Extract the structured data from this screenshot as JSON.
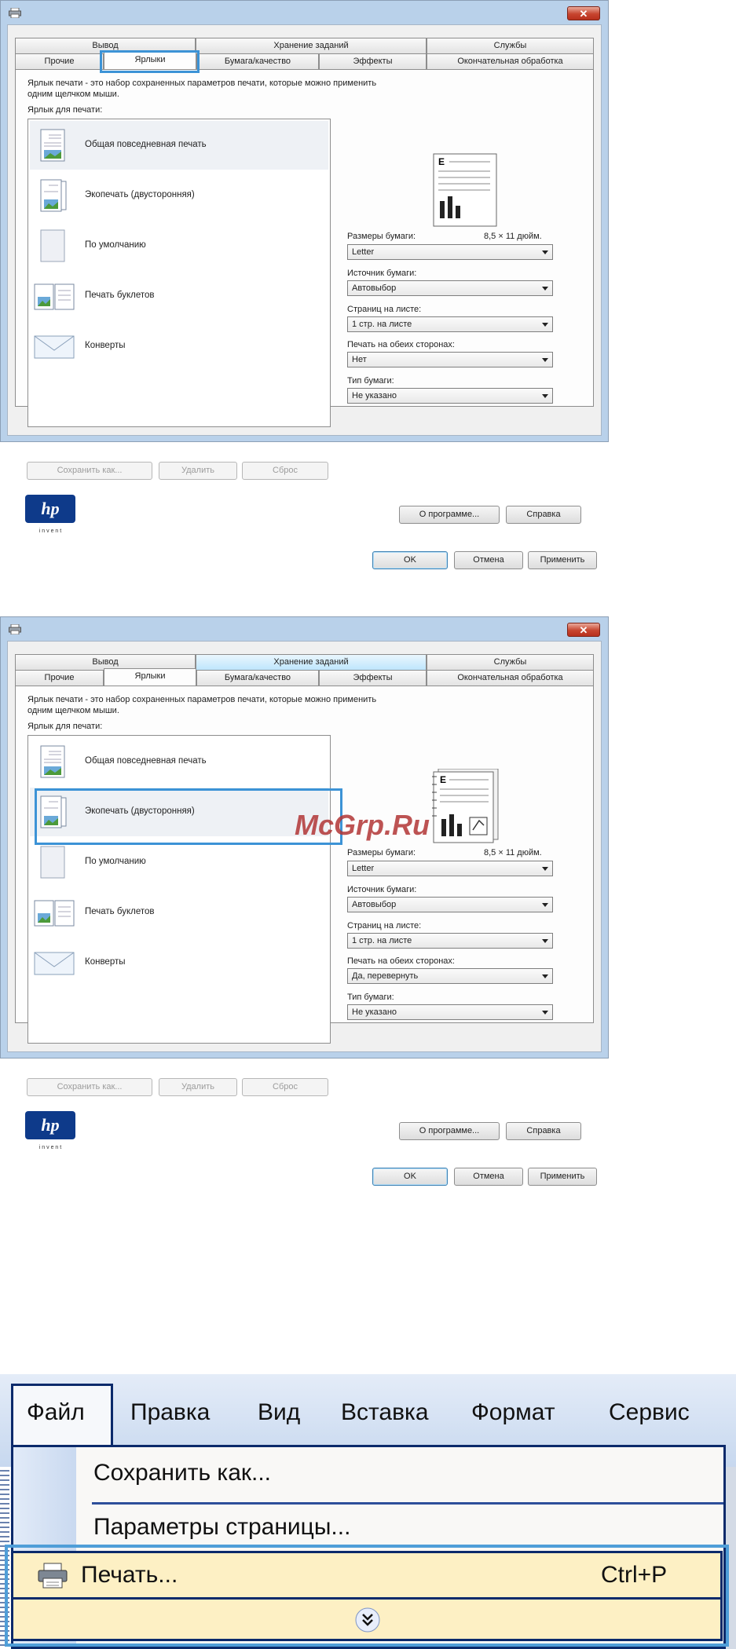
{
  "dialog_a": {
    "tabs_top": [
      "Вывод",
      "Хранение заданий",
      "Службы"
    ],
    "tabs_bottom": [
      "Прочие",
      "Ярлыки",
      "Бумага/качество",
      "Эффекты",
      "Окончательная обработка"
    ],
    "description": "Ярлык печати - это набор сохраненных параметров печати, которые можно применить одним щелчком мыши.",
    "shortcut_label": "Ярлык для печати:",
    "shortcuts": [
      "Общая повседневная печать",
      "Экопечать (двусторонняя)",
      "По умолчанию",
      "Печать буклетов",
      "Конверты"
    ],
    "paper_size_label": "Размеры бумаги:",
    "paper_size_value": "8,5 × 11 дюйм.",
    "paper_size": "Letter",
    "paper_source_label": "Источник бумаги:",
    "paper_source": "Автовыбор",
    "pages_per_sheet_label": "Страниц на листе:",
    "pages_per_sheet": "1 стр. на листе",
    "duplex_label": "Печать на обеих сторонах:",
    "duplex": "Нет",
    "paper_type_label": "Тип бумаги:",
    "paper_type": "Не указано",
    "btn_save_as": "Сохранить как...",
    "btn_delete": "Удалить",
    "btn_reset": "Сброс",
    "btn_about": "О программе...",
    "btn_help": "Справка",
    "btn_ok": "OK",
    "btn_cancel": "Отмена",
    "btn_apply": "Применить",
    "logo_text": "hp",
    "logo_sub": "i n v e n t"
  },
  "dialog_b": {
    "tabs_top": [
      "Вывод",
      "Хранение заданий",
      "Службы"
    ],
    "tabs_bottom": [
      "Прочие",
      "Ярлыки",
      "Бумага/качество",
      "Эффекты",
      "Окончательная обработка"
    ],
    "description": "Ярлык печати - это набор сохраненных параметров печати, которые можно применить одним щелчком мыши.",
    "shortcut_label": "Ярлык для печати:",
    "shortcuts": [
      "Общая повседневная печать",
      "Экопечать (двусторонняя)",
      "По умолчанию",
      "Печать буклетов",
      "Конверты"
    ],
    "paper_size_label": "Размеры бумаги:",
    "paper_size_value": "8,5 × 11 дюйм.",
    "paper_size": "Letter",
    "paper_source_label": "Источник бумаги:",
    "paper_source": "Автовыбор",
    "pages_per_sheet_label": "Страниц на листе:",
    "pages_per_sheet": "1 стр. на листе",
    "duplex_label": "Печать на обеих сторонах:",
    "duplex": "Да, перевернуть",
    "paper_type_label": "Тип бумаги:",
    "paper_type": "Не указано",
    "btn_save_as": "Сохранить как...",
    "btn_delete": "Удалить",
    "btn_reset": "Сброс",
    "btn_about": "О программе...",
    "btn_help": "Справка",
    "btn_ok": "OK",
    "btn_cancel": "Отмена",
    "btn_apply": "Применить",
    "logo_text": "hp",
    "logo_sub": "i n v e n t"
  },
  "watermark": "McGrp.Ru",
  "menu": {
    "bar": [
      "Файл",
      "Правка",
      "Вид",
      "Вставка",
      "Формат",
      "Сервис"
    ],
    "items": [
      "Сохранить как...",
      "Параметры страницы..."
    ],
    "print_label": "Печать...",
    "print_shortcut": "Ctrl+P",
    "expand_icon": "chevron-double-down-icon"
  },
  "colors": {
    "highlight": "#3c93d6",
    "menu_border": "#0b2a6b",
    "menu_hover": "#fdf0c4"
  }
}
